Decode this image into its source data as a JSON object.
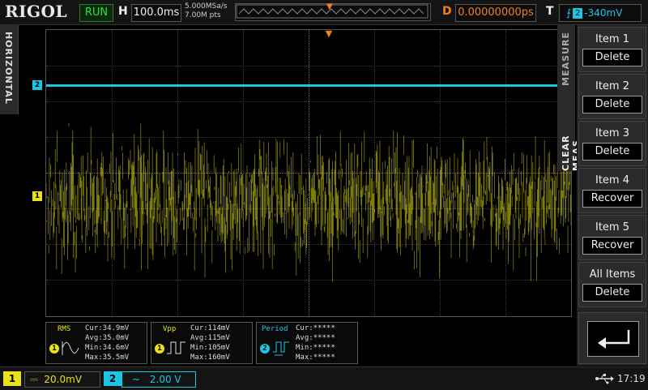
{
  "brand": "RIGOL",
  "status": "RUN",
  "timebase": {
    "label": "H",
    "value": "100.0ms"
  },
  "acquisition": {
    "sample_rate": "5.000MSa/s",
    "points": "7.00M pts"
  },
  "delay": {
    "label": "D",
    "value": "0.00000000ps"
  },
  "trigger": {
    "label": "T",
    "source": "2",
    "level": "-340mV"
  },
  "horizontal_tab": "HORIZONTAL",
  "side_tabs": {
    "measure": "MEASURE",
    "clear_meas": "CLEAR MEAS"
  },
  "menu": [
    {
      "label": "Item 1",
      "value": "Delete"
    },
    {
      "label": "Item 2",
      "value": "Delete"
    },
    {
      "label": "Item 3",
      "value": "Delete"
    },
    {
      "label": "Item 4",
      "value": "Recover"
    },
    {
      "label": "Item 5",
      "value": "Recover"
    },
    {
      "label": "All Items",
      "value": "Delete"
    }
  ],
  "markers": {
    "ch1": "1",
    "ch2": "2"
  },
  "measurements": [
    {
      "name": "RMS",
      "channel": "1",
      "cur": "Cur:34.9mV",
      "avg": "Avg:35.0mV",
      "min": "Min:34.6mV",
      "max": "Max:35.5mV"
    },
    {
      "name": "Vpp",
      "channel": "1",
      "cur": "Cur:114mV",
      "avg": "Avg:115mV",
      "min": "Min:105mV",
      "max": "Max:160mV"
    },
    {
      "name": "Period",
      "channel": "2",
      "cur": "Cur:*****",
      "avg": "Avg:*****",
      "min": "Min:*****",
      "max": "Max:*****"
    }
  ],
  "channels": [
    {
      "number": "1",
      "coupling": "⎓",
      "scale": "20.0mV"
    },
    {
      "number": "2",
      "coupling": "~",
      "scale": "2.00 V"
    }
  ],
  "clock": "17:19",
  "colors": {
    "ch1": "#e8e21a",
    "ch2": "#19c6e6",
    "trigger": "#f08020",
    "run": "#2fe04a"
  },
  "icons": {
    "usb": "usb-icon",
    "back": "back-arrow-icon",
    "trigger_edge": "rising-edge-icon"
  }
}
